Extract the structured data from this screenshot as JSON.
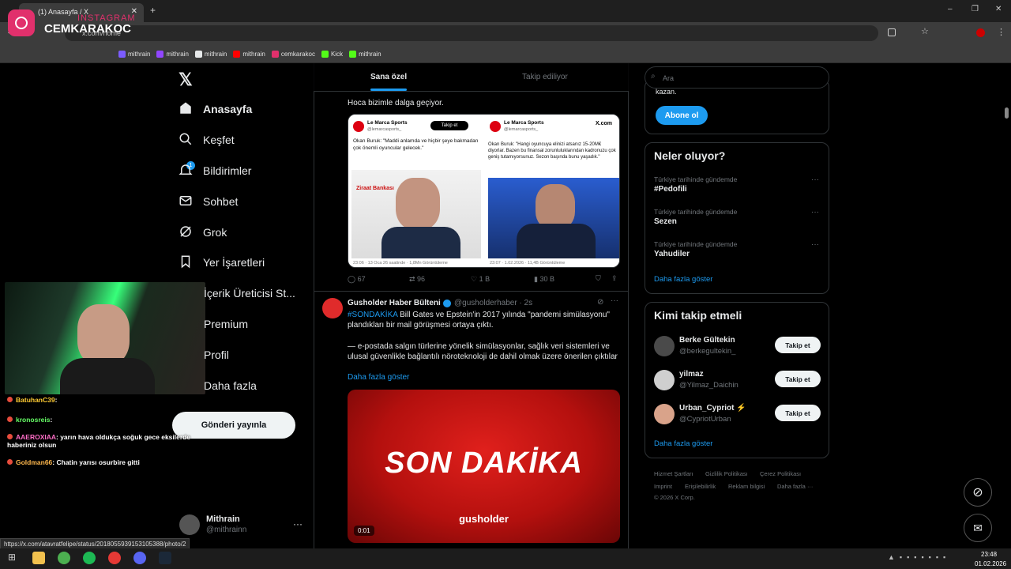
{
  "browser": {
    "tab_title": "(1) Anasayfa / X",
    "url": "x.com/home",
    "status_url": "https://x.com/atavratfelipe/status/2018055939153105388/photo/2",
    "bookmarks": [
      "mithrain",
      "mithrain",
      "mithrain",
      "mithrain",
      "cemkarakoc",
      "Kick",
      "mithrain"
    ],
    "bookmark_colors": [
      "#7c5cff",
      "#9146ff",
      "#e7e9ea",
      "#ff0000",
      "#e1306c",
      "#53fc18",
      "#53fc18"
    ]
  },
  "overlay": {
    "brand_top": "INSTAGRAM",
    "brand_name": "CEMKARAKOC"
  },
  "nav": {
    "items": [
      {
        "label": "Anasayfa",
        "icon": "home-icon"
      },
      {
        "label": "Keşfet",
        "icon": "search-icon"
      },
      {
        "label": "Bildirimler",
        "icon": "bell-icon"
      },
      {
        "label": "Sohbet",
        "icon": "mail-icon"
      },
      {
        "label": "Grok",
        "icon": "grok-icon"
      },
      {
        "label": "Yer İşaretleri",
        "icon": "bookmark-icon"
      },
      {
        "label": "İçerik Üreticisi St...",
        "icon": "creator-icon"
      },
      {
        "label": "Premium",
        "icon": "x-icon"
      },
      {
        "label": "Profil",
        "icon": "user-icon"
      },
      {
        "label": "Daha fazla",
        "icon": "more-icon"
      }
    ],
    "notification_badge": "1",
    "post_button": "Gönderi yayınla",
    "account": {
      "name": "Mithrain",
      "handle": "@mithrainn"
    }
  },
  "feed": {
    "tabs": [
      "Sana özel",
      "Takip ediliyor"
    ],
    "tweet1": {
      "text": "Hoca bizimle dalga geçiyor.",
      "left_card": {
        "name": "Le Marca Sports",
        "handle": "@lemarcasports_",
        "follow": "Takip et",
        "quote": "Okan Buruk: \"Maddi anlamda ve hiçbir şeye bakmadan çok önemli oyuncular gelecek.\"",
        "footer": "23:06 · 13 Oca 26 saatinde · 1,8Mn Görüntüleme"
      },
      "right_card": {
        "name": "Le Marca Sports",
        "handle": "@lemarcasports_",
        "site": "X.com",
        "quote": "Okan Buruk: \"Hangi oyuncuya elinizi atsanız 15-20M€ diyorlar. Bazen bu finansal zorunluluklarından kadronuzu çok geniş tutamıyorsunuz. Sezon başında bunu yaşadık.\"",
        "footer": "23:07 · 1.02.2026 · 11,4B Görüntüleme"
      },
      "stats": {
        "replies": "67",
        "reposts": "96",
        "likes": "1 B",
        "views": "30 B"
      }
    },
    "tweet2": {
      "author": "Gusholder Haber Bülteni",
      "handle": "@gusholderhaber · 2s",
      "hashtag": "#SONDAKİKA",
      "text1": " Bill Gates ve Epstein'in 2017 yılında \"pandemi simülasyonu\" plandıkları bir mail görüşmesi ortaya çıktı.",
      "text2": "— e-postada salgın türlerine yönelik simülasyonlar, sağlık veri sistemleri ve ulusal güvenlikle bağlantılı nöroteknoloji de dahil olmak üzere önerilen çıktılar",
      "show_more": "Daha fazla göster",
      "media_title": "SON DAKİKA",
      "media_brand": "gusholder",
      "video_time": "0:01"
    }
  },
  "right": {
    "search_placeholder": "Ara",
    "premium_tail": "kazan.",
    "subscribe": "Abone ol",
    "trends_title": "Neler oluyor?",
    "trends": [
      {
        "context": "Türkiye tarihinde gündemde",
        "topic": "#Pedofili"
      },
      {
        "context": "Türkiye tarihinde gündemde",
        "topic": "Sezen"
      },
      {
        "context": "Türkiye tarihinde gündemde",
        "topic": "Yahudiler"
      }
    ],
    "trends_more": "Daha fazla göster",
    "wtf_title": "Kimi takip etmeli",
    "who": [
      {
        "name": "Berke Gültekin",
        "handle": "@berkegultekin_",
        "follow": "Takip et"
      },
      {
        "name": "yilmaz",
        "handle": "@Yilmaz_Daichin",
        "follow": "Takip et"
      },
      {
        "name": "Urban_Cypriot ⚡",
        "handle": "@CypriotUrban",
        "follow": "Takip et"
      }
    ],
    "wtf_more": "Daha fazla göster",
    "footer": [
      "Hizmet Şartları",
      "Gizlilik Politikası",
      "Çerez Politikası",
      "Imprint",
      "Erişilebilirlik",
      "Reklam bilgisi",
      "Daha fazla ···",
      "© 2026 X Corp."
    ]
  },
  "chat": [
    {
      "user": "BatuhanC39",
      "msg": ":"
    },
    {
      "user": "kronosreis",
      "msg": ":"
    },
    {
      "user": "AAEROXIAA",
      "msg": ": yarın hava oldukça soğuk gece eksilerde haberiniz olsun"
    },
    {
      "user": "Goldman66",
      "msg": ": Chatin yarısı osurbire gitti"
    }
  ],
  "chat_colors": [
    "#ffcc33",
    "#66ff66",
    "#ff6ec7",
    "#ffb84d"
  ],
  "taskbar": {
    "time": "23:48",
    "date": "01.02.2026"
  },
  "colors": {
    "accent": "#1d9bf0",
    "background": "#000000",
    "border": "#2f3336",
    "muted": "#71767b"
  }
}
